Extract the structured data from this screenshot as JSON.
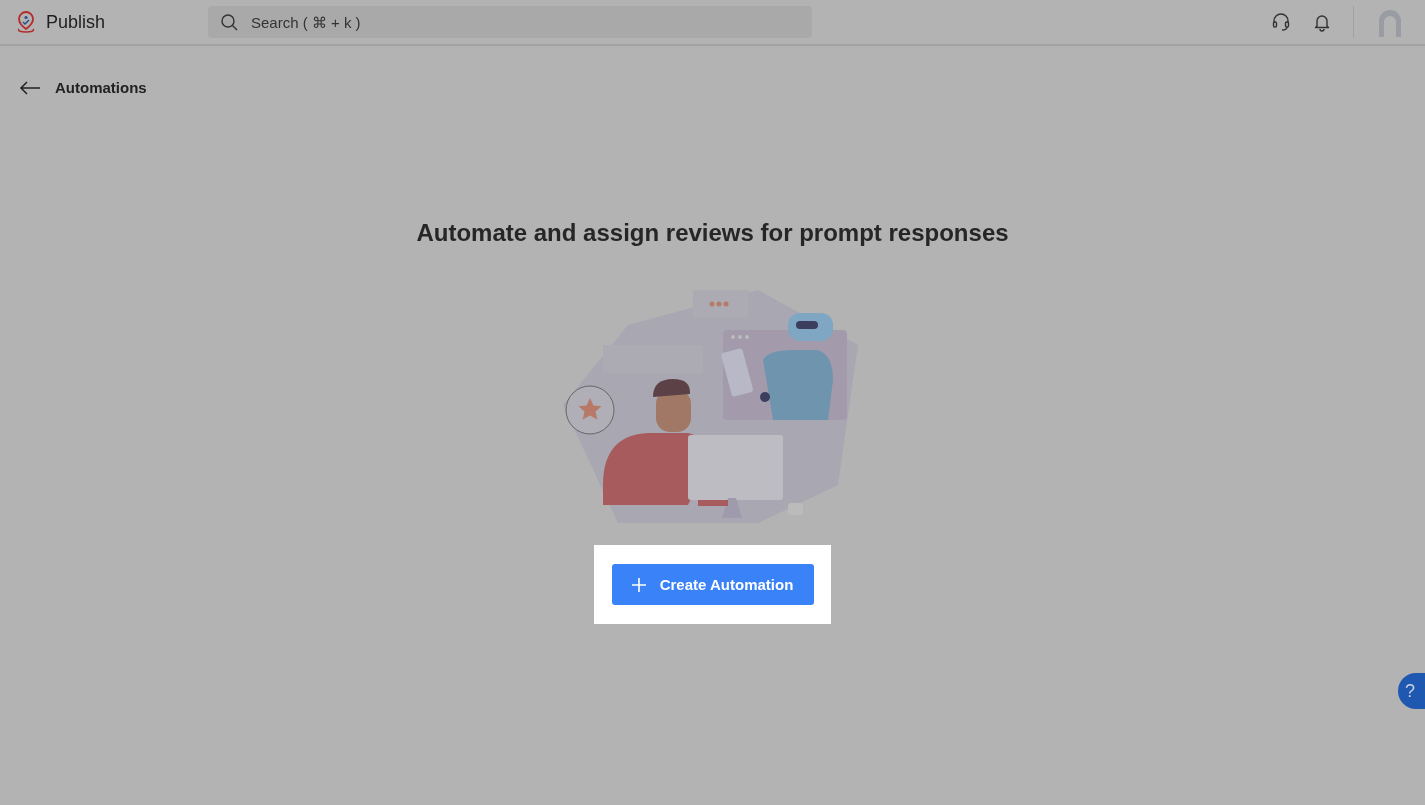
{
  "header": {
    "app_name": "Publish",
    "search": {
      "placeholder": "Search ( ⌘ + k )"
    }
  },
  "page": {
    "back_label": "Automations"
  },
  "empty_state": {
    "heading": "Automate and assign reviews for prompt responses",
    "button": {
      "label": "Create Automation"
    }
  },
  "help_button": {
    "label": "?"
  }
}
